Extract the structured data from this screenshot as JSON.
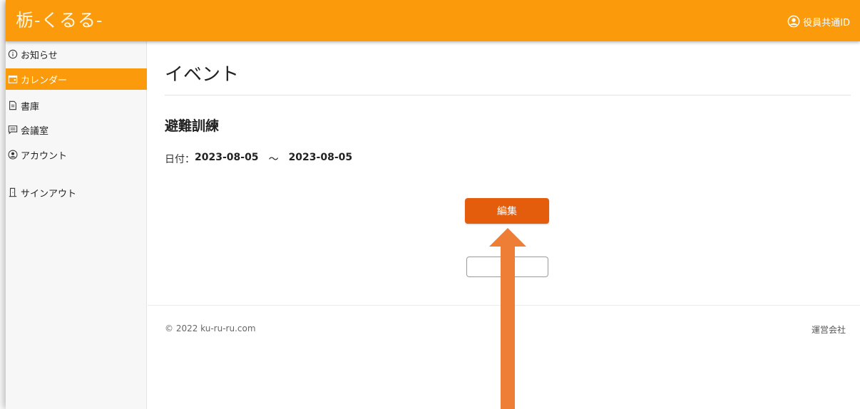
{
  "header": {
    "logo": "栃-くるる-",
    "user_label": "役員共通ID"
  },
  "sidebar": {
    "items": [
      {
        "label": "お知らせ",
        "icon": "info-icon"
      },
      {
        "label": "カレンダー",
        "icon": "calendar-icon",
        "active": true
      },
      {
        "label": "書庫",
        "icon": "document-icon"
      },
      {
        "label": "会議室",
        "icon": "chat-icon"
      },
      {
        "label": "アカウント",
        "icon": "user-circle-icon"
      },
      {
        "label": "サインアウト",
        "icon": "door-icon"
      }
    ]
  },
  "main": {
    "page_title": "イベント",
    "event_name": "避難訓練",
    "date_label": "日付：",
    "date_start": "2023-08-05",
    "date_separator": "～",
    "date_end": "2023-08-05",
    "edit_button": "編集"
  },
  "footer": {
    "copyright": "© 2022 ku-ru-ru.com",
    "company_link": "運営会社"
  },
  "colors": {
    "header": "#fb9a0b",
    "active_nav": "#fb9a0b",
    "edit_button": "#e35d0c",
    "annotation_arrow": "#ee7d35"
  }
}
